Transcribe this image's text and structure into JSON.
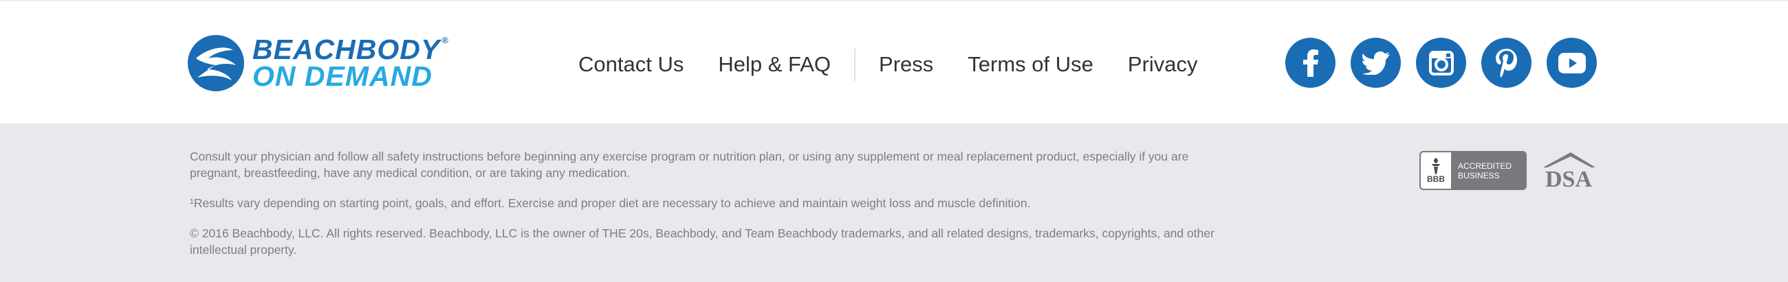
{
  "logo": {
    "line1": "BEACHBODY",
    "registered": "®",
    "line2": "ON DEMAND"
  },
  "nav": {
    "items": [
      "Contact Us",
      "Help & FAQ",
      "Press",
      "Terms of Use",
      "Privacy"
    ]
  },
  "social": {
    "icons": [
      "facebook-icon",
      "twitter-icon",
      "instagram-icon",
      "pinterest-icon",
      "youtube-icon"
    ]
  },
  "legal": {
    "p1": "Consult your physician and follow all safety instructions before beginning any exercise program or nutrition plan, or using any supplement or meal replacement product, especially if you are pregnant, breastfeeding, have any medical condition, or are taking any medication.",
    "p2": "¹Results vary depending on starting point, goals, and effort. Exercise and proper diet are necessary to achieve and maintain weight loss and muscle definition.",
    "p3": "© 2016 Beachbody, LLC. All rights reserved. Beachbody, LLC is the owner of THE 20s, Beachbody, and Team Beachbody trademarks, and all related designs, trademarks, copyrights, and other intellectual property."
  },
  "badges": {
    "bbb_small": "BBB",
    "bbb_line1": "ACCREDITED",
    "bbb_line2": "BUSINESS",
    "dsa": "DSA"
  },
  "colors": {
    "brand_blue": "#1a6cb4",
    "brand_light_blue": "#27a9e1",
    "footer_bg": "#e9e9ed",
    "text_gray": "#7d7d82"
  }
}
